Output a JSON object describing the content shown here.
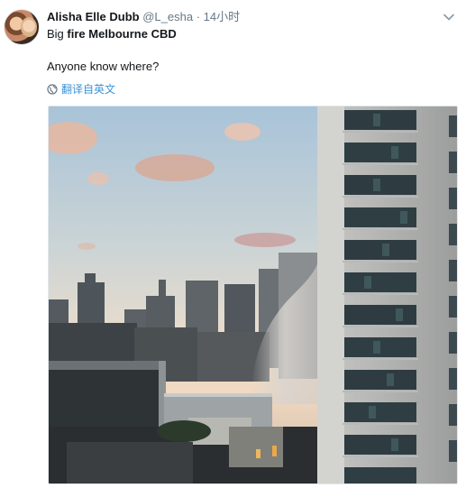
{
  "tweet": {
    "author_name": "Alisha Elle Dubb",
    "author_handle": "@L_esha",
    "separator": "·",
    "timestamp": "14小时",
    "text_prefix": "Big ",
    "text_bold": "fire Melbourne CBD",
    "text_line2": "Anyone know where?",
    "translate_label": "翻译自英文"
  },
  "icons": {
    "avatar": "profile-photo",
    "caret": "chevron-down-icon",
    "translate": "globe-icon"
  },
  "colors": {
    "link": "#3b94d9",
    "secondary_text": "#657786",
    "primary_text": "#14171a"
  }
}
